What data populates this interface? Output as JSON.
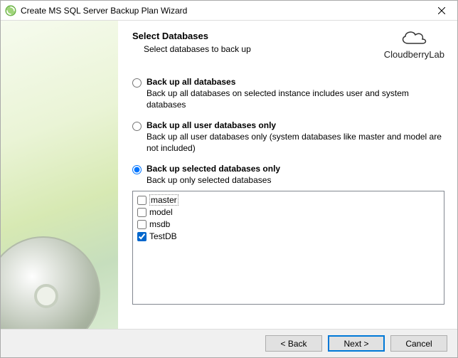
{
  "window": {
    "title": "Create MS SQL Server Backup Plan Wizard"
  },
  "header": {
    "title": "Select Databases",
    "subtitle": "Select databases to back up"
  },
  "brand": {
    "name": "CloudberryLab"
  },
  "options": {
    "all": {
      "label": "Back up all databases",
      "desc": "Back up all databases on selected instance includes user and system databases"
    },
    "user": {
      "label": "Back up all user databases only",
      "desc": "Back up all user databases only (system databases like master and model are not included)"
    },
    "selected": {
      "label": "Back up selected databases only",
      "desc": "Back up only selected databases"
    }
  },
  "databases": [
    {
      "name": "master",
      "checked": false
    },
    {
      "name": "model",
      "checked": false
    },
    {
      "name": "msdb",
      "checked": false
    },
    {
      "name": "TestDB",
      "checked": true
    }
  ],
  "buttons": {
    "back": "< Back",
    "next": "Next >",
    "cancel": "Cancel"
  }
}
